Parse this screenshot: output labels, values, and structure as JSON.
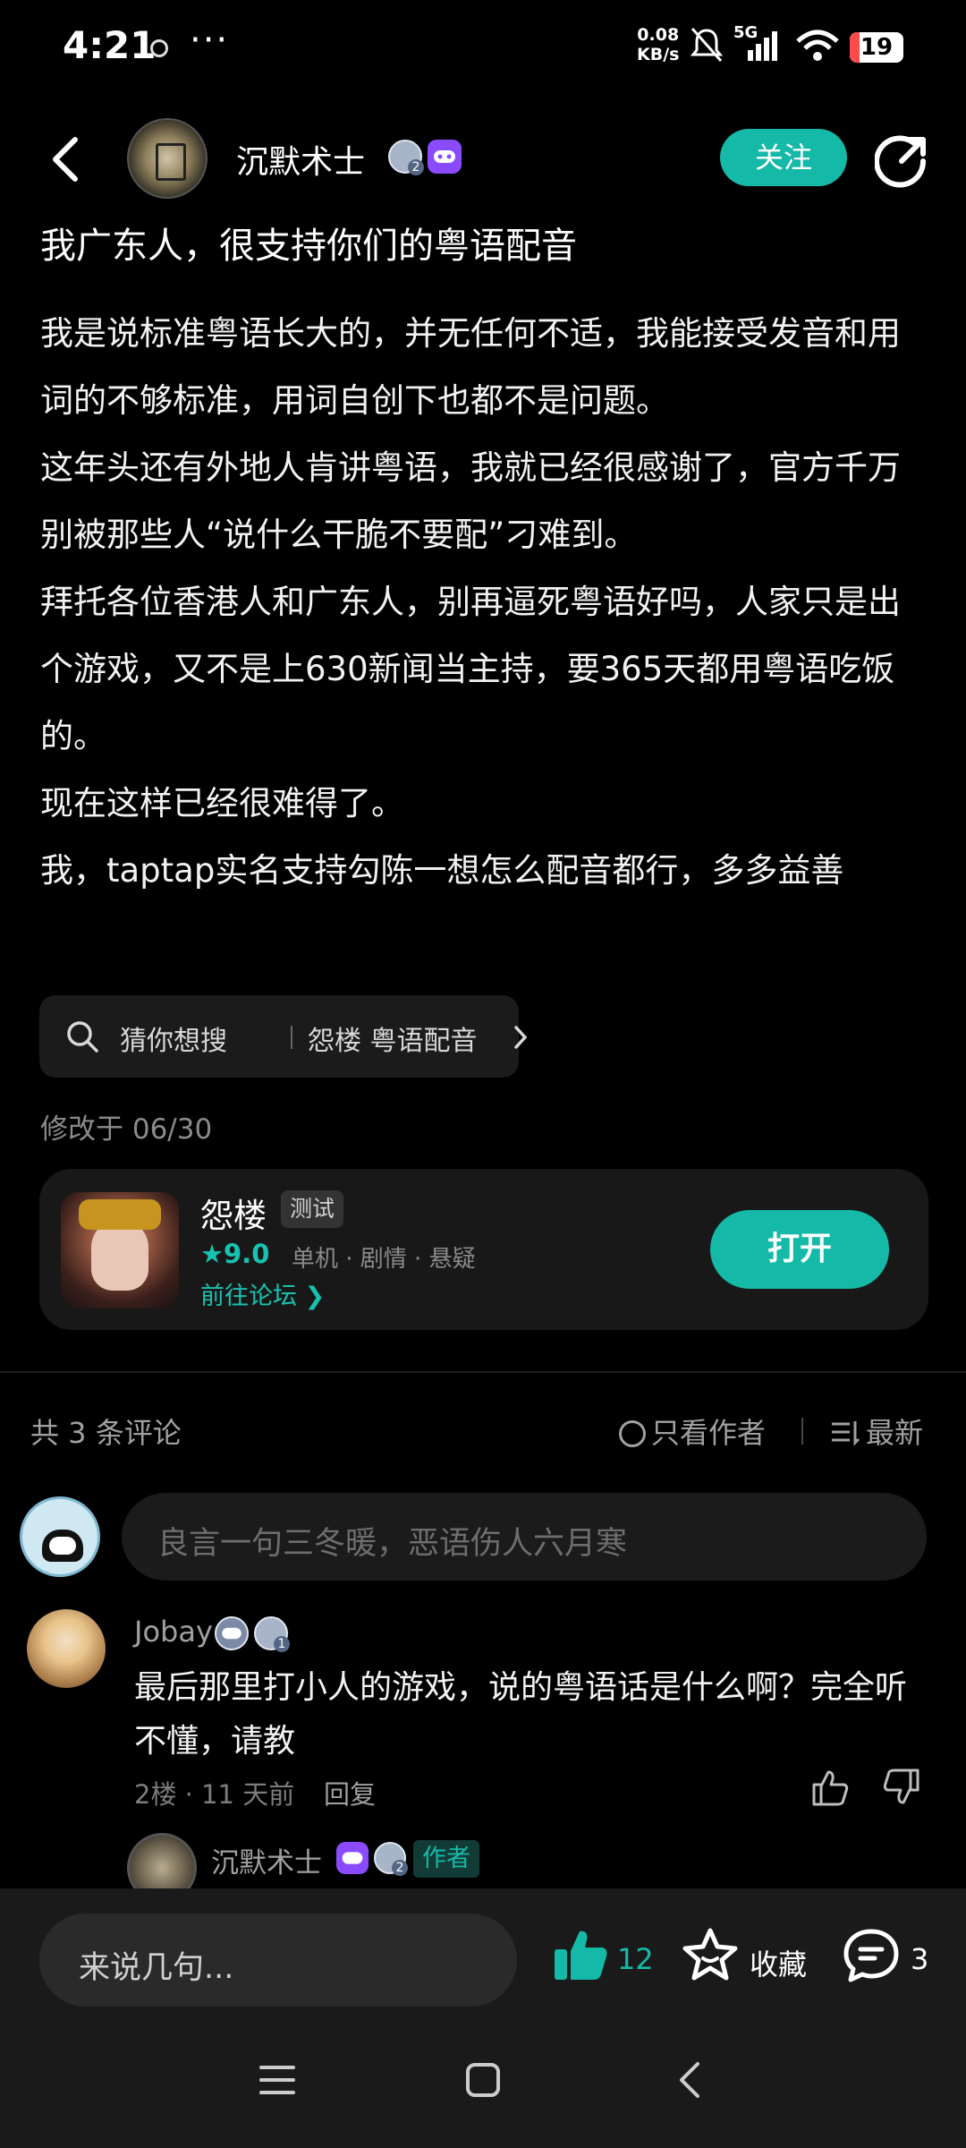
{
  "status_bar": {
    "time": "4:21",
    "more": "···",
    "net_speed_value": "0.08",
    "net_speed_unit": "KB/s",
    "network": "5G",
    "battery": "19",
    "battery_level": 0.19,
    "battery_color": "#ff4b4b"
  },
  "header": {
    "author_name": "沉默术士",
    "level_badge": "2",
    "follow_label": "关注"
  },
  "post": {
    "title": "我广东人，很支持你们的粤语配音",
    "paragraphs": [
      "我是说标准粤语长大的，并无任何不适，我能接受发音和用词的不够标准，用词自创下也都不是问题。",
      "这年头还有外地人肯讲粤语，我就已经很感谢了，官方千万别被那些人“说什么干脆不要配”刁难到。",
      "拜托各位香港人和广东人，别再逼死粤语好吗，人家只是出个游戏，又不是上630新闻当主持，要365天都用粤语吃饭的。",
      "现在这样已经很难得了。",
      "我，taptap实名支持勾陈一想怎么配音都行，多多益善"
    ],
    "search_label": "猜你想搜",
    "search_term": "怨楼 粤语配音",
    "modified": "修改于 06/30"
  },
  "game_card": {
    "name": "怨楼",
    "tag": "测试",
    "score": "★9.0",
    "genres": "单机 · 剧情 · 悬疑",
    "forum_link": "前往论坛 ❯",
    "open_label": "打开"
  },
  "comments": {
    "count_label": "共 3 条评论",
    "only_author": "只看作者",
    "sort": "最新",
    "input_placeholder": "良言一句三冬暖，恶语伤人六月寒",
    "items": [
      {
        "name": "Jobay",
        "level_badge": "1",
        "text": "最后那里打小人的游戏，说的粤语话是什么啊？完全听不懂，请教",
        "meta": "2楼 · 11 天前",
        "reply": "回复"
      }
    ],
    "reply_preview": {
      "name": "沉默术士",
      "level_badge": "2",
      "author_tag": "作者"
    }
  },
  "bottom_bar": {
    "say_placeholder": "来说几句...",
    "like_count": "12",
    "fav_label": "收藏",
    "comment_count": "3"
  },
  "colors": {
    "accent": "#14b9a8",
    "background": "#000000",
    "card": "#181818",
    "muted_text": "#a0a0a0"
  },
  "icons": [
    "back-icon",
    "share-icon",
    "search-icon",
    "chevron-right-icon",
    "thumb-up-icon",
    "thumb-down-icon",
    "star-icon",
    "comment-icon",
    "menu-icon",
    "home-icon",
    "nav-back-icon",
    "game-controller-icon"
  ]
}
